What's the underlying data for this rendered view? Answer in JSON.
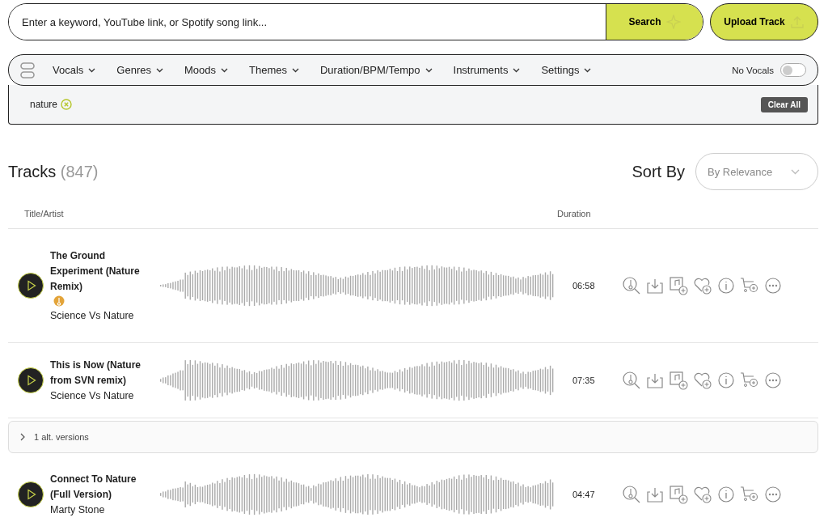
{
  "search": {
    "placeholder": "Enter a keyword, YouTube link, or Spotify song link...",
    "button": "Search"
  },
  "upload_button": "Upload Track",
  "filters": [
    {
      "label": "Vocals"
    },
    {
      "label": "Genres"
    },
    {
      "label": "Moods"
    },
    {
      "label": "Themes"
    },
    {
      "label": "Duration/BPM/Tempo"
    },
    {
      "label": "Instruments"
    },
    {
      "label": "Settings"
    }
  ],
  "no_vocals": {
    "label": "No Vocals",
    "on": false
  },
  "active_filters": [
    {
      "label": "nature"
    }
  ],
  "clear_all": "Clear All",
  "tracks_heading": {
    "title": "Tracks",
    "count": "(847)"
  },
  "sort": {
    "label": "Sort By",
    "value": "By Relevance"
  },
  "columns": [
    "Title/Artist",
    "Duration"
  ],
  "tracks": [
    {
      "title": "The Ground Experiment (Nature Remix)",
      "artist": "Science Vs Nature",
      "duration": "06:58",
      "badge": true
    },
    {
      "title": "This is Now (Nature from SVN remix)",
      "artist": "Science Vs Nature",
      "duration": "07:35",
      "badge": false,
      "alt_versions": "1 alt. versions"
    },
    {
      "title": "Connect To Nature (Full Version)",
      "artist": "Marty Stone",
      "duration": "04:47",
      "badge": false
    }
  ]
}
